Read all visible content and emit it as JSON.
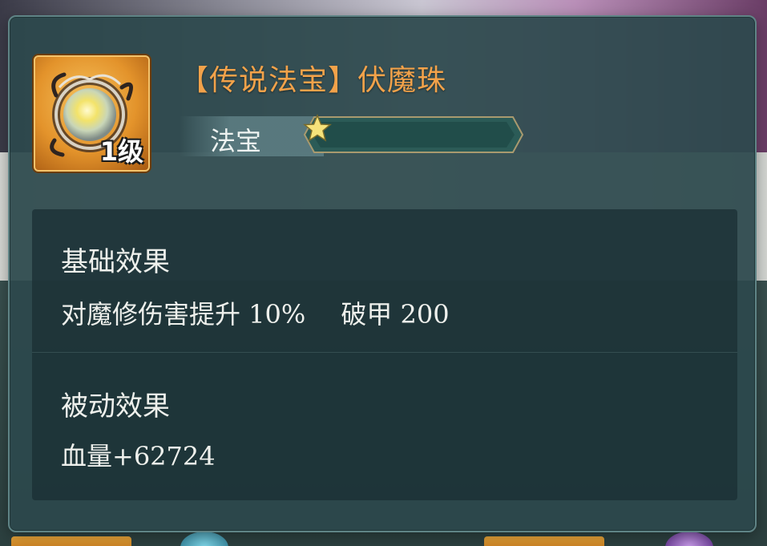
{
  "item": {
    "title_open": "【",
    "title_quality": "传说法宝",
    "title_close": "】",
    "title_name": "伏魔珠",
    "level_badge": "1级",
    "type_label": "法宝",
    "stars": 1,
    "icon": "orb-treasure-icon"
  },
  "effects": {
    "base_title": "基础效果",
    "base_stat_1": "对魔修伤害提升 10%",
    "base_stat_2": "破甲 200",
    "passive_title": "被动效果",
    "passive_stat": "血量+62724"
  },
  "colors": {
    "title": "#f2a24a",
    "panel_bg": "#2c484c",
    "text": "#eef0ec",
    "star": "#f6e27a"
  }
}
